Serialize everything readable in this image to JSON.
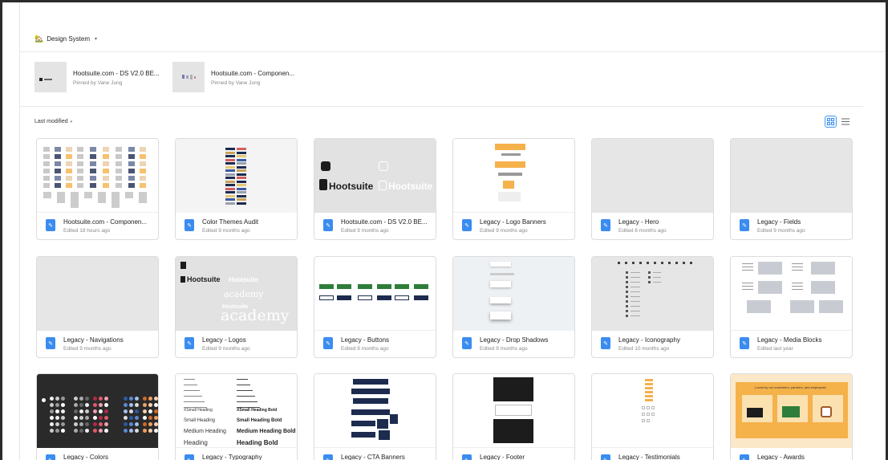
{
  "header": {
    "title": "Design System",
    "house_icon": "🏡"
  },
  "pinned": [
    {
      "title": "Hootsuite.com - DS V2.0 BE...",
      "sub": "Pinned by Vane Jung"
    },
    {
      "title": "Hootsuite.com - Componen...",
      "sub": "Pinned by Vane Jung"
    }
  ],
  "sort_label": "Last modified",
  "files": [
    {
      "name": "Hootsuite.com - Componen...",
      "edited": "Edited 18 hours ago",
      "preview": "components"
    },
    {
      "name": "Color Themes Audit",
      "edited": "Edited 9 months ago",
      "preview": "colorthemes"
    },
    {
      "name": "Hootsuite.com - DS V2.0 BE...",
      "edited": "Edited 9 months ago",
      "preview": "hootlogo"
    },
    {
      "name": "Legacy - Logo Banners",
      "edited": "Edited 9 months ago",
      "preview": "logobanners"
    },
    {
      "name": "Legacy - Hero",
      "edited": "Edited 8 months ago",
      "preview": "blank"
    },
    {
      "name": "Legacy - Fields",
      "edited": "Edited 9 months ago",
      "preview": "blank"
    },
    {
      "name": "Legacy - Navigations",
      "edited": "Edited 9 months ago",
      "preview": "blank"
    },
    {
      "name": "Legacy - Logos",
      "edited": "Edited 9 months ago",
      "preview": "logos"
    },
    {
      "name": "Legacy - Buttons",
      "edited": "Edited 9 months ago",
      "preview": "buttons"
    },
    {
      "name": "Legacy - Drop Shadows",
      "edited": "Edited 9 months ago",
      "preview": "shadows"
    },
    {
      "name": "Legacy - Iconography",
      "edited": "Edited 10 months ago",
      "preview": "icons"
    },
    {
      "name": "Legacy - Media Blocks",
      "edited": "Edited last year",
      "preview": "media"
    },
    {
      "name": "Legacy - Colors",
      "edited": "",
      "preview": "colors"
    },
    {
      "name": "Legacy - Typography",
      "edited": "",
      "preview": "typography"
    },
    {
      "name": "Legacy - CTA Banners",
      "edited": "",
      "preview": "cta"
    },
    {
      "name": "Legacy - Footer",
      "edited": "",
      "preview": "footer"
    },
    {
      "name": "Legacy - Testimonials",
      "edited": "",
      "preview": "testimonials"
    },
    {
      "name": "Legacy - Awards",
      "edited": "",
      "preview": "awards"
    }
  ],
  "preview_text": {
    "hootsuite": "Hootsuite",
    "academy": "academy",
    "typography_lines": [
      "XSmall Heading",
      "Small Heading",
      "Medium Heading",
      "Heading"
    ],
    "typography_bold_lines": [
      "XSmall Heading Bold",
      "Small Heading Bold",
      "Medium Heading Bold",
      "Heading Bold"
    ],
    "awards_heading": "Loved by our customers, partners, and employees"
  },
  "colors": {
    "accent": "#3a8cf0",
    "hoot_dark": "#1c1c1c",
    "green": "#2e7d3a",
    "navy": "#1d2b4f",
    "orange": "#f5b14a"
  }
}
